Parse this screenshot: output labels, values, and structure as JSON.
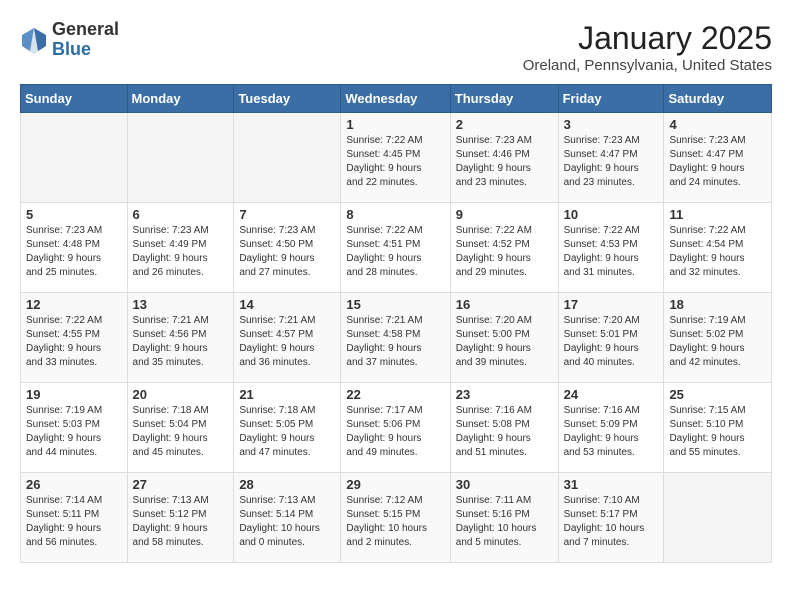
{
  "header": {
    "logo_general": "General",
    "logo_blue": "Blue",
    "title": "January 2025",
    "subtitle": "Oreland, Pennsylvania, United States"
  },
  "weekdays": [
    "Sunday",
    "Monday",
    "Tuesday",
    "Wednesday",
    "Thursday",
    "Friday",
    "Saturday"
  ],
  "weeks": [
    [
      {
        "day": "",
        "info": ""
      },
      {
        "day": "",
        "info": ""
      },
      {
        "day": "",
        "info": ""
      },
      {
        "day": "1",
        "info": "Sunrise: 7:22 AM\nSunset: 4:45 PM\nDaylight: 9 hours\nand 22 minutes."
      },
      {
        "day": "2",
        "info": "Sunrise: 7:23 AM\nSunset: 4:46 PM\nDaylight: 9 hours\nand 23 minutes."
      },
      {
        "day": "3",
        "info": "Sunrise: 7:23 AM\nSunset: 4:47 PM\nDaylight: 9 hours\nand 23 minutes."
      },
      {
        "day": "4",
        "info": "Sunrise: 7:23 AM\nSunset: 4:47 PM\nDaylight: 9 hours\nand 24 minutes."
      }
    ],
    [
      {
        "day": "5",
        "info": "Sunrise: 7:23 AM\nSunset: 4:48 PM\nDaylight: 9 hours\nand 25 minutes."
      },
      {
        "day": "6",
        "info": "Sunrise: 7:23 AM\nSunset: 4:49 PM\nDaylight: 9 hours\nand 26 minutes."
      },
      {
        "day": "7",
        "info": "Sunrise: 7:23 AM\nSunset: 4:50 PM\nDaylight: 9 hours\nand 27 minutes."
      },
      {
        "day": "8",
        "info": "Sunrise: 7:22 AM\nSunset: 4:51 PM\nDaylight: 9 hours\nand 28 minutes."
      },
      {
        "day": "9",
        "info": "Sunrise: 7:22 AM\nSunset: 4:52 PM\nDaylight: 9 hours\nand 29 minutes."
      },
      {
        "day": "10",
        "info": "Sunrise: 7:22 AM\nSunset: 4:53 PM\nDaylight: 9 hours\nand 31 minutes."
      },
      {
        "day": "11",
        "info": "Sunrise: 7:22 AM\nSunset: 4:54 PM\nDaylight: 9 hours\nand 32 minutes."
      }
    ],
    [
      {
        "day": "12",
        "info": "Sunrise: 7:22 AM\nSunset: 4:55 PM\nDaylight: 9 hours\nand 33 minutes."
      },
      {
        "day": "13",
        "info": "Sunrise: 7:21 AM\nSunset: 4:56 PM\nDaylight: 9 hours\nand 35 minutes."
      },
      {
        "day": "14",
        "info": "Sunrise: 7:21 AM\nSunset: 4:57 PM\nDaylight: 9 hours\nand 36 minutes."
      },
      {
        "day": "15",
        "info": "Sunrise: 7:21 AM\nSunset: 4:58 PM\nDaylight: 9 hours\nand 37 minutes."
      },
      {
        "day": "16",
        "info": "Sunrise: 7:20 AM\nSunset: 5:00 PM\nDaylight: 9 hours\nand 39 minutes."
      },
      {
        "day": "17",
        "info": "Sunrise: 7:20 AM\nSunset: 5:01 PM\nDaylight: 9 hours\nand 40 minutes."
      },
      {
        "day": "18",
        "info": "Sunrise: 7:19 AM\nSunset: 5:02 PM\nDaylight: 9 hours\nand 42 minutes."
      }
    ],
    [
      {
        "day": "19",
        "info": "Sunrise: 7:19 AM\nSunset: 5:03 PM\nDaylight: 9 hours\nand 44 minutes."
      },
      {
        "day": "20",
        "info": "Sunrise: 7:18 AM\nSunset: 5:04 PM\nDaylight: 9 hours\nand 45 minutes."
      },
      {
        "day": "21",
        "info": "Sunrise: 7:18 AM\nSunset: 5:05 PM\nDaylight: 9 hours\nand 47 minutes."
      },
      {
        "day": "22",
        "info": "Sunrise: 7:17 AM\nSunset: 5:06 PM\nDaylight: 9 hours\nand 49 minutes."
      },
      {
        "day": "23",
        "info": "Sunrise: 7:16 AM\nSunset: 5:08 PM\nDaylight: 9 hours\nand 51 minutes."
      },
      {
        "day": "24",
        "info": "Sunrise: 7:16 AM\nSunset: 5:09 PM\nDaylight: 9 hours\nand 53 minutes."
      },
      {
        "day": "25",
        "info": "Sunrise: 7:15 AM\nSunset: 5:10 PM\nDaylight: 9 hours\nand 55 minutes."
      }
    ],
    [
      {
        "day": "26",
        "info": "Sunrise: 7:14 AM\nSunset: 5:11 PM\nDaylight: 9 hours\nand 56 minutes."
      },
      {
        "day": "27",
        "info": "Sunrise: 7:13 AM\nSunset: 5:12 PM\nDaylight: 9 hours\nand 58 minutes."
      },
      {
        "day": "28",
        "info": "Sunrise: 7:13 AM\nSunset: 5:14 PM\nDaylight: 10 hours\nand 0 minutes."
      },
      {
        "day": "29",
        "info": "Sunrise: 7:12 AM\nSunset: 5:15 PM\nDaylight: 10 hours\nand 2 minutes."
      },
      {
        "day": "30",
        "info": "Sunrise: 7:11 AM\nSunset: 5:16 PM\nDaylight: 10 hours\nand 5 minutes."
      },
      {
        "day": "31",
        "info": "Sunrise: 7:10 AM\nSunset: 5:17 PM\nDaylight: 10 hours\nand 7 minutes."
      },
      {
        "day": "",
        "info": ""
      }
    ]
  ]
}
